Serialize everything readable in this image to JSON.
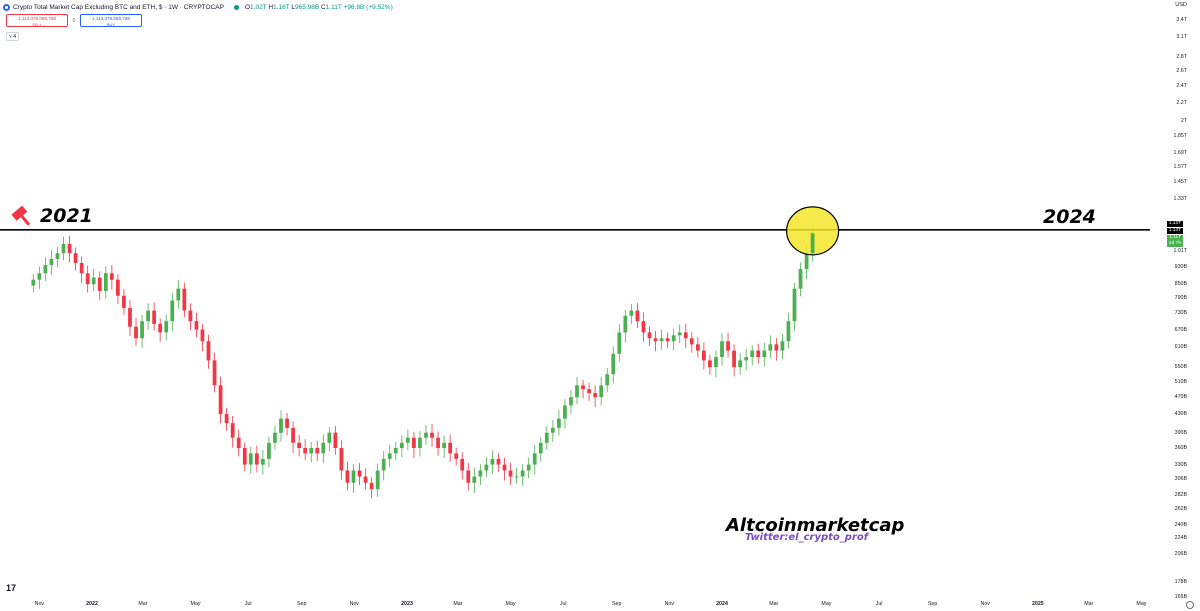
{
  "header": {
    "title": "Crypto Total Market Cap Excluding BTC and ETH, $ · 1W · CRYPTOCAP",
    "ohlc": [
      {
        "key": "O",
        "value": "1.02T"
      },
      {
        "key": "H",
        "value": "1.16T"
      },
      {
        "key": "L",
        "value": "965.98B"
      },
      {
        "key": "C",
        "value": "1.11T"
      },
      {
        "key": "",
        "value": "+96.8B (+9.52%)"
      }
    ]
  },
  "trade": {
    "sell_value": "1,113,378,096,768",
    "sell_label": "SELL",
    "spread": "0",
    "buy_value": "1,113,378,096,768",
    "buy_label": "BUY"
  },
  "indicator_toggle": "4",
  "currency": "USD",
  "colors": {
    "up": "#4caf50",
    "down": "#f23645",
    "line": "#000000",
    "highlight": "#f5e52a"
  },
  "annotations": {
    "left_year": "2021",
    "right_year": "2024",
    "watermark": "Altcoinmarketcap",
    "twitter": "Twitter:el_crypto_prof"
  },
  "tags": {
    "last_price": "1.11T",
    "countdown": "2d 7h",
    "line_a": "1.13T",
    "line_b": "1.13T"
  },
  "chart_data": {
    "type": "candlestick",
    "title": "Crypto Total Market Cap Excluding BTC and ETH, $ · 1W · CRYPTOCAP",
    "y_scale": "log",
    "ylim": [
      0.14,
      3.5
    ],
    "y_unit": "trillion USD",
    "y_ticks": [
      "3.4T",
      "3.1T",
      "2.8T",
      "2.6T",
      "2.4T",
      "2.2T",
      "2T",
      "1.85T",
      "1.69T",
      "1.57T",
      "1.45T",
      "1.33T",
      "1.01T",
      "930B",
      "850B",
      "790B",
      "730B",
      "670B",
      "610B",
      "550B",
      "510B",
      "470B",
      "430B",
      "390B",
      "360B",
      "330B",
      "306B",
      "282B",
      "262B",
      "240B",
      "224B",
      "206B",
      "178B",
      "165B"
    ],
    "x_ticks": [
      "Nov",
      "2022",
      "Mar",
      "May",
      "Jul",
      "Sep",
      "Nov",
      "2023",
      "Mar",
      "May",
      "Jul",
      "Sep",
      "Nov",
      "2024",
      "Mar",
      "May",
      "Jul",
      "Sep",
      "Nov",
      "2025",
      "Mar",
      "May"
    ],
    "horizontal_line": 1.13,
    "close_series": [
      0.87,
      0.9,
      0.94,
      0.97,
      1.0,
      1.05,
      1.0,
      0.95,
      0.9,
      0.85,
      0.88,
      0.82,
      0.9,
      0.87,
      0.8,
      0.75,
      0.68,
      0.64,
      0.7,
      0.74,
      0.69,
      0.66,
      0.7,
      0.78,
      0.83,
      0.74,
      0.7,
      0.67,
      0.63,
      0.57,
      0.5,
      0.43,
      0.41,
      0.38,
      0.36,
      0.33,
      0.35,
      0.33,
      0.34,
      0.37,
      0.39,
      0.42,
      0.4,
      0.37,
      0.36,
      0.35,
      0.36,
      0.35,
      0.37,
      0.39,
      0.36,
      0.32,
      0.3,
      0.32,
      0.31,
      0.3,
      0.29,
      0.32,
      0.34,
      0.35,
      0.36,
      0.37,
      0.38,
      0.36,
      0.38,
      0.39,
      0.38,
      0.36,
      0.37,
      0.35,
      0.34,
      0.32,
      0.3,
      0.31,
      0.32,
      0.33,
      0.34,
      0.33,
      0.32,
      0.31,
      0.31,
      0.32,
      0.33,
      0.35,
      0.37,
      0.39,
      0.4,
      0.42,
      0.45,
      0.47,
      0.5,
      0.49,
      0.48,
      0.47,
      0.5,
      0.53,
      0.59,
      0.66,
      0.72,
      0.74,
      0.7,
      0.66,
      0.64,
      0.63,
      0.64,
      0.63,
      0.65,
      0.66,
      0.64,
      0.62,
      0.6,
      0.57,
      0.55,
      0.58,
      0.63,
      0.6,
      0.55,
      0.57,
      0.58,
      0.6,
      0.58,
      0.6,
      0.62,
      0.6,
      0.63,
      0.7,
      0.83,
      0.92,
      1.0,
      1.11
    ],
    "start_date": "2021-10-25",
    "interval": "1W"
  }
}
